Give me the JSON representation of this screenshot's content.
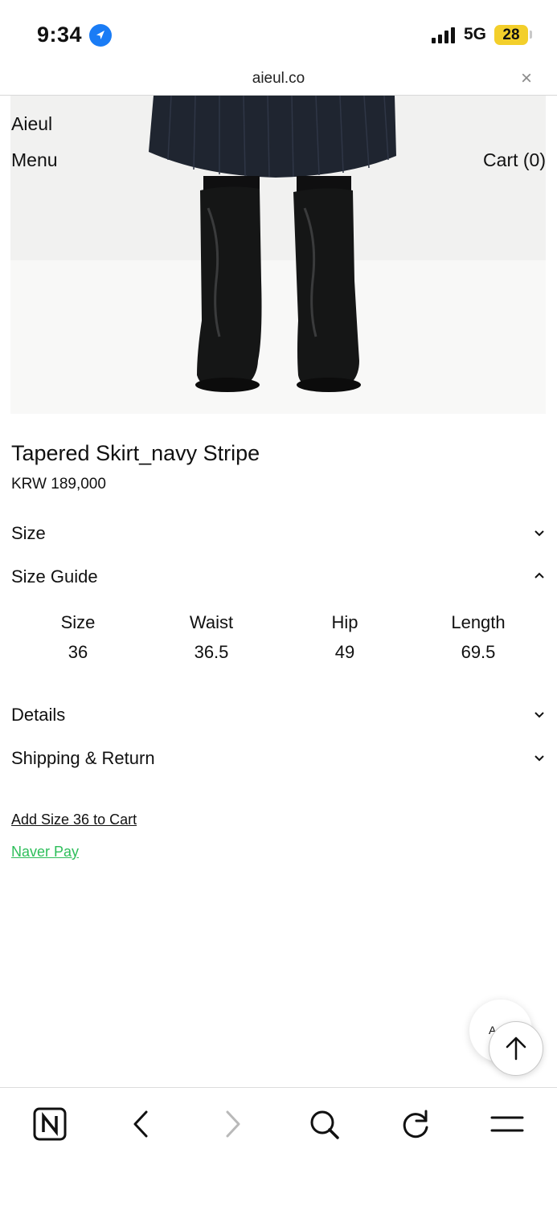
{
  "status": {
    "time": "9:34",
    "network": "5G",
    "battery": "28"
  },
  "browser": {
    "url": "aieul.co",
    "close_symbol": "×"
  },
  "site": {
    "logo": "Aieul",
    "menu": "Menu",
    "cart": "Cart (0)"
  },
  "product": {
    "title": "Tapered Skirt_navy Stripe",
    "price": "KRW 189,000"
  },
  "accordion": {
    "size": "Size",
    "size_guide": "Size Guide",
    "details": "Details",
    "shipping": "Shipping & Return"
  },
  "size_guide": {
    "headers": [
      "Size",
      "Waist",
      "Hip",
      "Length"
    ],
    "rows": [
      [
        "36",
        "36.5",
        "49",
        "69.5"
      ]
    ]
  },
  "actions": {
    "add_to_cart": "Add Size 36 to Cart",
    "naver_pay": "Naver Pay"
  },
  "floating": {
    "a_label": "A"
  },
  "icons": {
    "location": "location-arrow-icon",
    "close": "close-icon",
    "chevron_down": "chevron-down-icon",
    "chevron_up": "chevron-up-icon",
    "scroll_top": "arrow-up-icon",
    "naver": "naver-n-icon",
    "back": "chevron-left-icon",
    "forward": "chevron-right-icon",
    "search": "search-icon",
    "reload": "reload-icon",
    "menu": "hamburger-icon"
  },
  "colors": {
    "accent_blue": "#1a7cf5",
    "battery_yellow": "#f3cf2b",
    "naver_green": "#2dbe5a",
    "text": "#111111"
  }
}
